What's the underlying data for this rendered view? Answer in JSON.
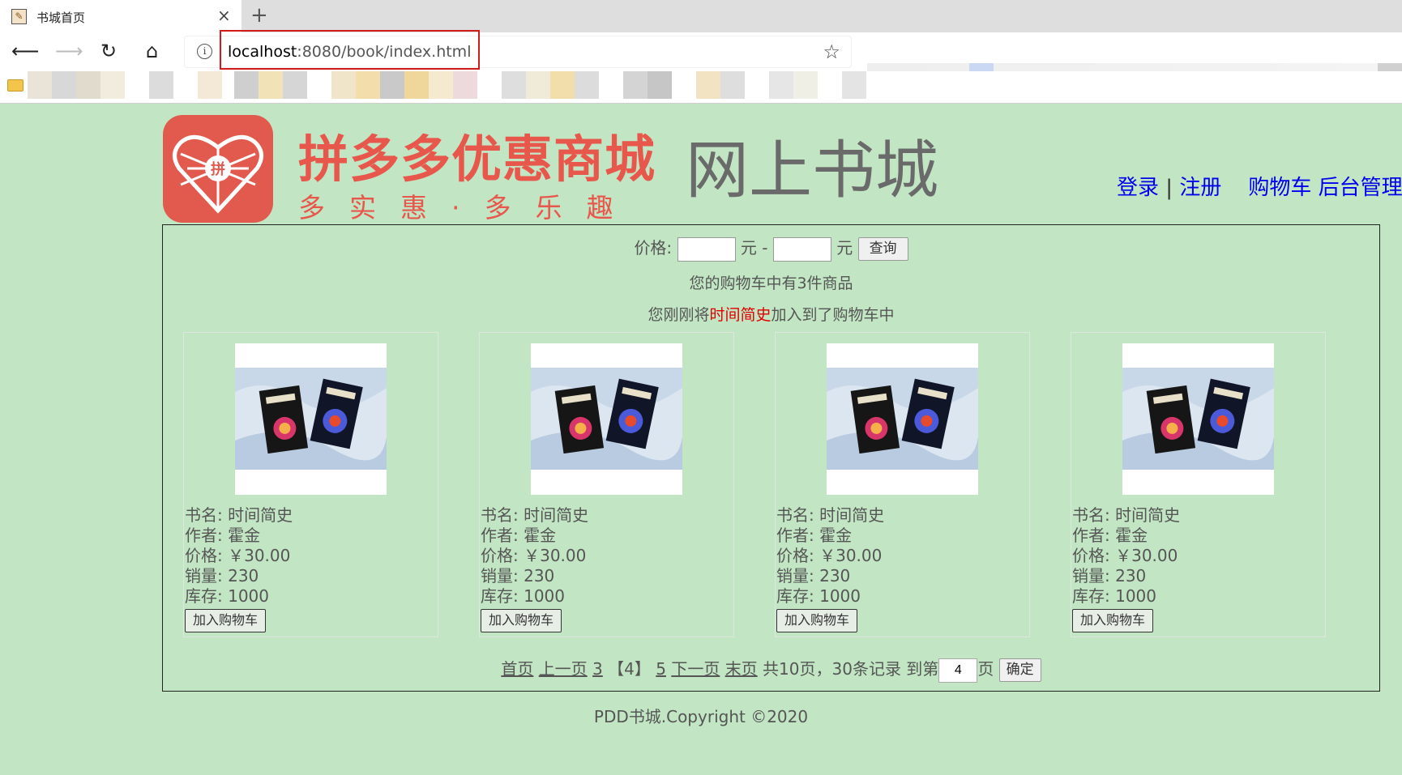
{
  "browser": {
    "tab_title": "书城首页",
    "tab_close": "×",
    "new_tab": "+",
    "url_host": "localhost",
    "url_rest": ":8080/book/index.html"
  },
  "header": {
    "brand_title": "拼多多优惠商城",
    "brand_slogan": "多实惠·多乐趣",
    "site_title": "网上书城",
    "links": {
      "login": "登录",
      "separator": "|",
      "register": "注册",
      "cart": "购物车",
      "admin": "后台管理"
    }
  },
  "search": {
    "label": "价格:",
    "unit": "元",
    "dash": "-",
    "button": "查询"
  },
  "cart": {
    "count_text": "您的购物车中有3件商品",
    "msg_prefix": "您刚刚将",
    "last_item": "时间简史",
    "msg_suffix": "加入到了购物车中"
  },
  "books": [
    {
      "name": "书名: 时间简史",
      "author": "作者: 霍金",
      "price": "价格: ￥30.00",
      "sales": "销量: 230",
      "stock": "库存: 1000",
      "add_label": "加入购物车"
    },
    {
      "name": "书名: 时间简史",
      "author": "作者: 霍金",
      "price": "价格: ￥30.00",
      "sales": "销量: 230",
      "stock": "库存: 1000",
      "add_label": "加入购物车"
    },
    {
      "name": "书名: 时间简史",
      "author": "作者: 霍金",
      "price": "价格: ￥30.00",
      "sales": "销量: 230",
      "stock": "库存: 1000",
      "add_label": "加入购物车"
    },
    {
      "name": "书名: 时间简史",
      "author": "作者: 霍金",
      "price": "价格: ￥30.00",
      "sales": "销量: 230",
      "stock": "库存: 1000",
      "add_label": "加入购物车"
    }
  ],
  "pager": {
    "first": "首页",
    "prev": "上一页",
    "page_prev_num": "3",
    "current": "【4】",
    "page_next_num": "5",
    "next": "下一页",
    "last": "末页",
    "summary": "共10页，30条记录 到第",
    "goto_value": "4",
    "page_suffix": "页",
    "confirm": "确定"
  },
  "footer": {
    "text": "PDD书城.Copyright ©2020"
  }
}
